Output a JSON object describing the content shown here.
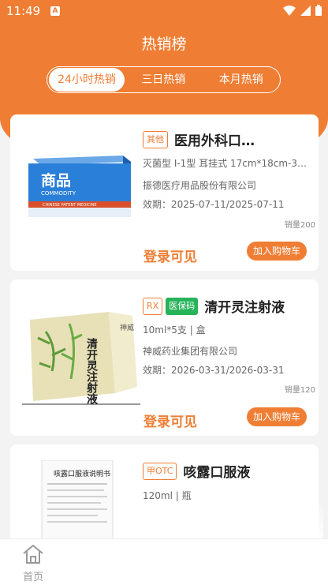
{
  "status": {
    "time": "11:49",
    "a_icon": "A"
  },
  "header": {
    "title": "热销榜"
  },
  "tabs": [
    {
      "label": "24小时热销",
      "active": true
    },
    {
      "label": "三日热销",
      "active": false
    },
    {
      "label": "本月热销",
      "active": false
    }
  ],
  "products": [
    {
      "tags": [
        "其他"
      ],
      "name": "医用外科口…",
      "spec": "灭菌型 I-1型 耳挂式 17cm*18cm-3…",
      "maker": "振德医疗用品股份有限公司",
      "expiry": "效期：2025-07-11/2025-07-11",
      "sales": "销量200",
      "price_label": "登录可见",
      "cart_label": "加入购物车",
      "image_text_main": "商品",
      "image_text_sub": "COMMODITY",
      "image_text_band": "CHINESE PATENT MEDICINE"
    },
    {
      "tags": [
        "RX",
        "医保码"
      ],
      "name": "清开灵注射液",
      "spec": "10ml*5支 | 盒",
      "maker": "神威药业集团有限公司",
      "expiry": "效期：2026-03-31/2026-03-31",
      "sales": "销量120",
      "price_label": "登录可见",
      "cart_label": "加入购物车",
      "image_text_main": "清开灵注射液",
      "image_text_brand": "神威"
    },
    {
      "tags": [
        "甲OTC"
      ],
      "name": "咳露口服液",
      "spec": "120ml | 瓶",
      "image_text_main": "咳露口服液说明书"
    }
  ],
  "bottom_nav": {
    "home_label": "首页"
  },
  "colors": {
    "accent": "#ef7e34",
    "green": "#27b35a"
  }
}
